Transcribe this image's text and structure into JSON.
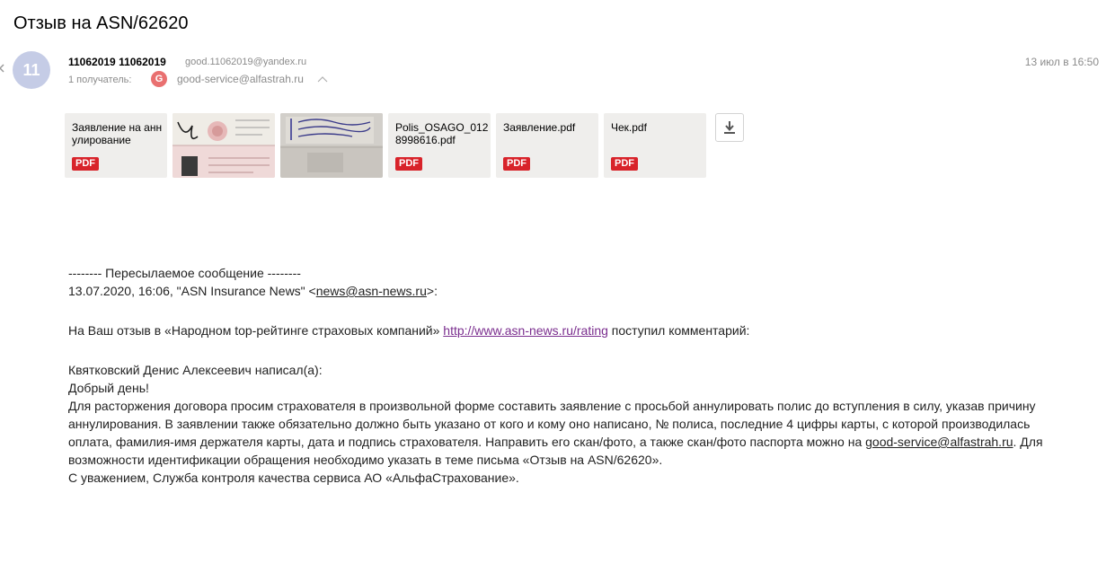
{
  "subject": "Отзыв на ASN/62620",
  "sender": {
    "avatar_text": "11",
    "name": "11062019 11062019",
    "email": "good.11062019@yandex.ru",
    "recipients_label": "1 получатель:",
    "recipient_badge": "G",
    "recipient_email": "good-service@alfastrah.ru",
    "date": "13 июл в 16:50"
  },
  "attachments": [
    {
      "name": "Заявление на аннулирование",
      "badge": "PDF"
    },
    {
      "name": "",
      "badge": ""
    },
    {
      "name": "",
      "badge": ""
    },
    {
      "name": "Polis_OSAGO_0128998616.pdf",
      "badge": "PDF"
    },
    {
      "name": "Заявление.pdf",
      "badge": "PDF"
    },
    {
      "name": "Чек.pdf",
      "badge": "PDF"
    }
  ],
  "body": {
    "forward_header": "-------- Пересылаемое сообщение --------",
    "forward_meta_prefix": "13.07.2020, 16:06, \"ASN Insurance News\" <",
    "forward_meta_email": "news@asn-news.ru",
    "forward_meta_suffix": ">:",
    "intro_prefix": "На Ваш отзыв в «Народном top-рейтинге страховых компаний» ",
    "intro_link": "http://www.asn-news.ru/rating",
    "intro_suffix": " поступил комментарий:",
    "author_line": "Квятковский Денис Алексеевич написал(а):",
    "greeting": "Добрый день!",
    "main_text_prefix": "Для расторжения договора просим страхователя в произвольной форме составить заявление с просьбой аннулировать полис до вступления в силу, указав причину аннулирования. В заявлении также обязательно должно быть указано от кого и кому оно написано, № полиса, последние 4 цифры карты, с которой производилась оплата, фамилия-имя держателя карты, дата и подпись страхователя. Направить его скан/фото, а также скан/фото паспорта можно на ",
    "main_text_email": "good-service@alfastrah.ru",
    "main_text_suffix": ". Для возможности идентификации обращения необходимо указать в теме письма «Отзыв на ASN/62620».",
    "signature": "С уважением, Служба контроля качества сервиса АО «АльфаСтрахование»."
  }
}
